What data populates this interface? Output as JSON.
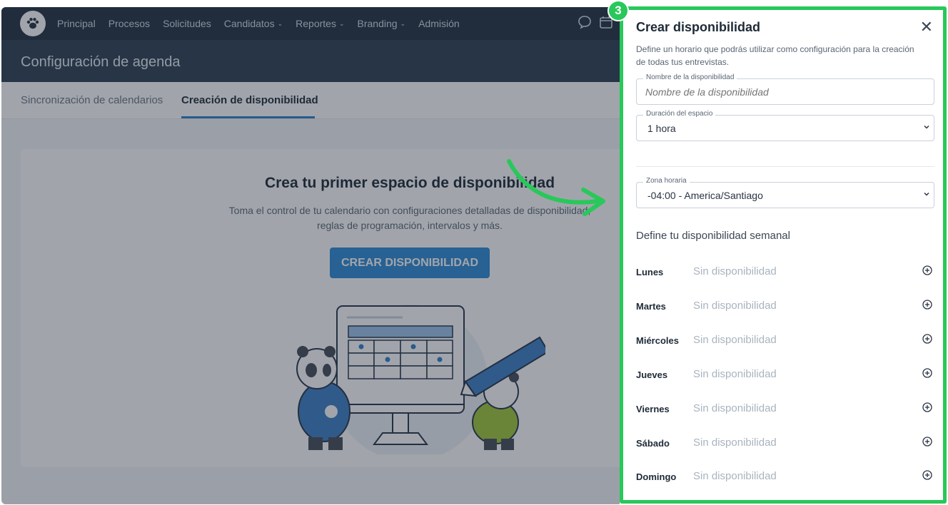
{
  "nav": {
    "items": [
      {
        "label": "Principal",
        "dropdown": false
      },
      {
        "label": "Procesos",
        "dropdown": false
      },
      {
        "label": "Solicitudes",
        "dropdown": false
      },
      {
        "label": "Candidatos",
        "dropdown": true
      },
      {
        "label": "Reportes",
        "dropdown": true
      },
      {
        "label": "Branding",
        "dropdown": true
      },
      {
        "label": "Admisión",
        "dropdown": false
      }
    ],
    "icons": [
      "chat-icon",
      "calendar-icon"
    ]
  },
  "page": {
    "title": "Configuración de agenda",
    "tabs": [
      {
        "label": "Sincronización de calendarios",
        "active": false
      },
      {
        "label": "Creación de disponibilidad",
        "active": true
      }
    ]
  },
  "empty_state": {
    "title": "Crea tu primer espacio de disponibilidad",
    "subtitle_line1": "Toma el control de tu calendario con configuraciones detalladas de disponibilidad,",
    "subtitle_line2": "reglas de programación, intervalos y más.",
    "button_label": "CREAR DISPONIBILIDAD"
  },
  "step_badge": "3",
  "drawer": {
    "title": "Crear disponibilidad",
    "close_label": "✕",
    "description": "Define un horario que podrás utilizar como configuración para la creación de todas tus entrevistas.",
    "name_field": {
      "label": "Nombre de la disponibilidad",
      "placeholder": "Nombre de la disponibilidad",
      "value": ""
    },
    "duration_field": {
      "label": "Duración del espacio",
      "value": "1 hora"
    },
    "timezone_field": {
      "label": "Zona horaria",
      "value": "-04:00 - America/Santiago"
    },
    "weekly_heading": "Define tu disponibilidad semanal",
    "days": [
      {
        "name": "Lunes",
        "status": "Sin disponibilidad"
      },
      {
        "name": "Martes",
        "status": "Sin disponibilidad"
      },
      {
        "name": "Miércoles",
        "status": "Sin disponibilidad"
      },
      {
        "name": "Jueves",
        "status": "Sin disponibilidad"
      },
      {
        "name": "Viernes",
        "status": "Sin disponibilidad"
      },
      {
        "name": "Sábado",
        "status": "Sin disponibilidad"
      },
      {
        "name": "Domingo",
        "status": "Sin disponibilidad"
      }
    ]
  },
  "colors": {
    "highlight": "#28c85a",
    "primary": "#2f8ad6",
    "nav_bg": "#233142"
  }
}
